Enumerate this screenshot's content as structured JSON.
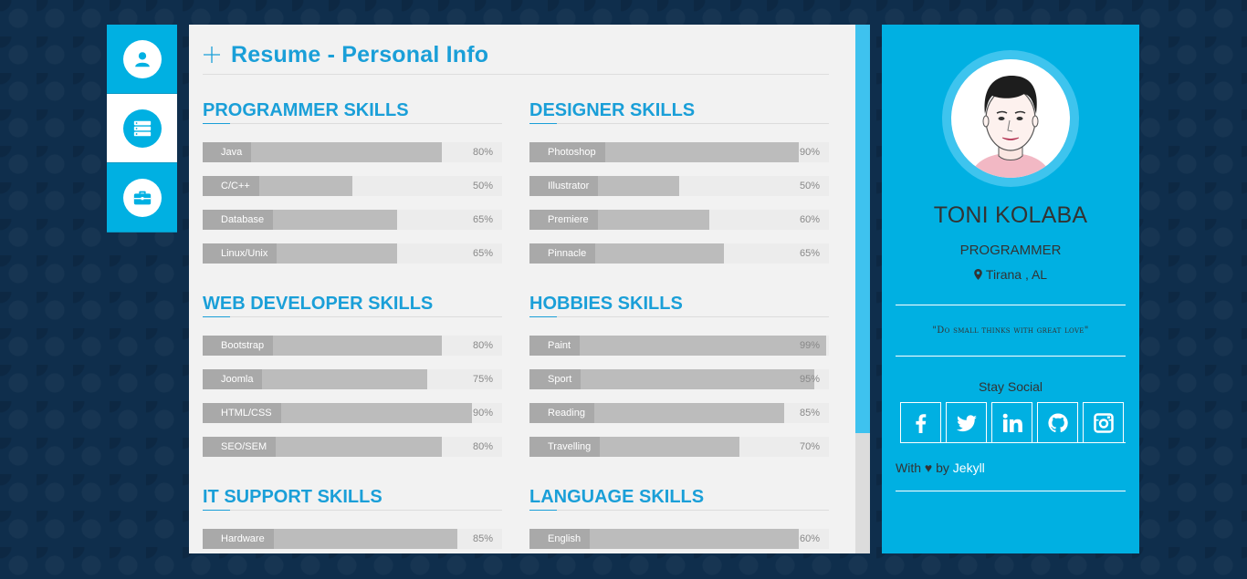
{
  "nav": {
    "items": [
      {
        "icon": "user-icon",
        "active": false
      },
      {
        "icon": "resume-icon",
        "active": true
      },
      {
        "icon": "briefcase-icon",
        "active": false
      }
    ]
  },
  "header": {
    "title": "Resume - Personal Info"
  },
  "sections": [
    {
      "title": "PROGRAMMER SKILLS",
      "skills": [
        {
          "name": "Java",
          "level": 80,
          "pct": "80%"
        },
        {
          "name": "C/C++",
          "level": 50,
          "pct": "50%"
        },
        {
          "name": "Database",
          "level": 65,
          "pct": "65%"
        },
        {
          "name": "Linux/Unix",
          "level": 65,
          "pct": "65%"
        }
      ]
    },
    {
      "title": "DESIGNER SKILLS",
      "skills": [
        {
          "name": "Photoshop",
          "level": 90,
          "pct": "90%"
        },
        {
          "name": "Illustrator",
          "level": 50,
          "pct": "50%"
        },
        {
          "name": "Premiere",
          "level": 60,
          "pct": "60%"
        },
        {
          "name": "Pinnacle",
          "level": 65,
          "pct": "65%"
        }
      ]
    },
    {
      "title": "WEB DEVELOPER SKILLS",
      "skills": [
        {
          "name": "Bootstrap",
          "level": 80,
          "pct": "80%"
        },
        {
          "name": "Joomla",
          "level": 75,
          "pct": "75%"
        },
        {
          "name": "HTML/CSS",
          "level": 90,
          "pct": "90%"
        },
        {
          "name": "SEO/SEM",
          "level": 80,
          "pct": "80%"
        }
      ]
    },
    {
      "title": "HOBBIES SKILLS",
      "skills": [
        {
          "name": "Paint",
          "level": 99,
          "pct": "99%"
        },
        {
          "name": "Sport",
          "level": 95,
          "pct": "95%"
        },
        {
          "name": "Reading",
          "level": 85,
          "pct": "85%"
        },
        {
          "name": "Travelling",
          "level": 70,
          "pct": "70%"
        }
      ]
    },
    {
      "title": "IT SUPPORT SKILLS",
      "skills": [
        {
          "name": "Hardware",
          "level": 85,
          "pct": "85%"
        }
      ]
    },
    {
      "title": "LANGUAGE SKILLS",
      "skills": [
        {
          "name": "English",
          "level": 90,
          "pct": "60%"
        }
      ]
    }
  ],
  "profile": {
    "name": "TONI KOLABA",
    "role": "PROGRAMMER",
    "location": "Tirana , AL",
    "quote": "\"Do small thinks with great love\"",
    "stay_social": "Stay Social",
    "socials": [
      "facebook-icon",
      "twitter-icon",
      "linkedin-icon",
      "github-icon",
      "instagram-icon"
    ],
    "credit_prefix": "With",
    "credit_heart": "♥",
    "credit_by": "by",
    "credit_link": "Jekyll"
  },
  "colors": {
    "accent": "#00b0e2",
    "title_blue": "#1a9fd8",
    "background": "#0f2e4c",
    "bar_fill": "#bcbcbc",
    "bar_label": "#a9a9a9"
  }
}
